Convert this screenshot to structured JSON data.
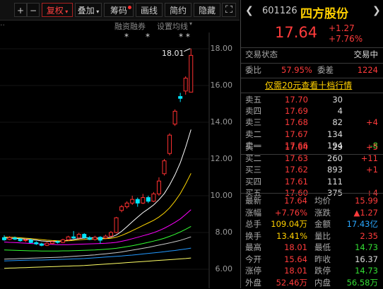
{
  "toolbar": {
    "add_label": "+",
    "minus_label": "−",
    "fuquan_label": "复权",
    "overlay_label": "叠加",
    "chips_label": "筹码",
    "draw_label": "画线",
    "simple_label": "简约",
    "hide_label": "隐藏"
  },
  "subbar": {
    "margin_label": "融资融券",
    "ma_settings_label": "设置均线",
    "markers": [
      "*",
      "*",
      "* *"
    ]
  },
  "chart": {
    "price_axis": [
      "18.00",
      "16.00",
      "14.00",
      "12.00",
      "10.00",
      "8.00",
      "6.00"
    ],
    "high_label": "18.01",
    "up_color": "#ff3030",
    "down_color": "#00e5ff",
    "candles": [
      {
        "o": 7.72,
        "c": 7.6,
        "h": 7.85,
        "l": 7.55
      },
      {
        "o": 7.62,
        "c": 7.72,
        "h": 7.8,
        "l": 7.58
      },
      {
        "o": 7.7,
        "c": 7.64,
        "h": 7.78,
        "l": 7.58
      },
      {
        "o": 7.64,
        "c": 7.55,
        "h": 7.7,
        "l": 7.5
      },
      {
        "o": 7.56,
        "c": 7.6,
        "h": 7.66,
        "l": 7.48
      },
      {
        "o": 7.58,
        "c": 7.45,
        "h": 7.66,
        "l": 7.42
      },
      {
        "o": 7.45,
        "c": 7.38,
        "h": 7.52,
        "l": 7.32
      },
      {
        "o": 7.38,
        "c": 7.3,
        "h": 7.44,
        "l": 7.25
      },
      {
        "o": 7.3,
        "c": 7.42,
        "h": 7.48,
        "l": 7.26
      },
      {
        "o": 7.4,
        "c": 7.5,
        "h": 7.56,
        "l": 7.36
      },
      {
        "o": 7.5,
        "c": 7.46,
        "h": 7.56,
        "l": 7.4
      },
      {
        "o": 7.46,
        "c": 7.6,
        "h": 7.66,
        "l": 7.42
      },
      {
        "o": 7.6,
        "c": 7.76,
        "h": 7.82,
        "l": 7.55
      },
      {
        "o": 7.76,
        "c": 7.7,
        "h": 8.08,
        "l": 7.65
      },
      {
        "o": 7.7,
        "c": 7.9,
        "h": 7.98,
        "l": 7.66
      },
      {
        "o": 7.9,
        "c": 7.72,
        "h": 7.96,
        "l": 7.66
      },
      {
        "o": 7.72,
        "c": 7.62,
        "h": 7.8,
        "l": 7.58
      },
      {
        "o": 7.62,
        "c": 7.74,
        "h": 7.82,
        "l": 7.56
      },
      {
        "o": 7.74,
        "c": 7.58,
        "h": 7.8,
        "l": 7.4
      },
      {
        "o": 7.7,
        "c": 7.8,
        "h": 7.88,
        "l": 7.64
      },
      {
        "o": 7.8,
        "c": 8.0,
        "h": 8.08,
        "l": 7.74
      },
      {
        "o": 8.0,
        "c": 8.8,
        "h": 8.85,
        "l": 7.95
      },
      {
        "o": 9.2,
        "c": 9.4,
        "h": 9.5,
        "l": 9.1
      },
      {
        "o": 9.4,
        "c": 9.6,
        "h": 9.7,
        "l": 9.3
      },
      {
        "o": 9.6,
        "c": 9.8,
        "h": 10.0,
        "l": 9.5
      },
      {
        "o": 9.8,
        "c": 9.6,
        "h": 9.9,
        "l": 9.4
      },
      {
        "o": 9.6,
        "c": 9.9,
        "h": 10.1,
        "l": 9.55
      },
      {
        "o": 9.9,
        "c": 9.7,
        "h": 10.0,
        "l": 9.6
      },
      {
        "o": 9.7,
        "c": 10.1,
        "h": 10.2,
        "l": 9.65
      },
      {
        "o": 10.1,
        "c": 10.8,
        "h": 11.0,
        "l": 10.0
      },
      {
        "o": 11.2,
        "c": 11.9,
        "h": 12.0,
        "l": 11.1
      },
      {
        "o": 12.3,
        "c": 13.3,
        "h": 13.4,
        "l": 12.2
      },
      {
        "o": 13.9,
        "c": 14.6,
        "h": 14.7,
        "l": 13.8
      },
      {
        "o": 15.4,
        "c": 15.3,
        "h": 15.6,
        "l": 15.1
      },
      {
        "o": 15.7,
        "c": 16.4,
        "h": 16.5,
        "l": 15.5
      },
      {
        "o": 15.64,
        "c": 17.64,
        "h": 18.01,
        "l": 15.64
      }
    ],
    "ma_lines": [
      {
        "color": "#ffffff",
        "values": [
          7.7,
          7.69,
          7.68,
          7.66,
          7.64,
          7.61,
          7.58,
          7.54,
          7.52,
          7.52,
          7.52,
          7.53,
          7.58,
          7.62,
          7.66,
          7.7,
          7.71,
          7.7,
          7.69,
          7.7,
          7.74,
          7.86,
          8.06,
          8.32,
          8.58,
          8.84,
          9.08,
          9.28,
          9.5,
          9.78,
          10.12,
          10.58,
          11.14,
          11.8,
          12.64,
          13.6
        ]
      },
      {
        "color": "#ffd700",
        "values": [
          7.75,
          7.74,
          7.73,
          7.71,
          7.69,
          7.67,
          7.64,
          7.61,
          7.58,
          7.56,
          7.55,
          7.54,
          7.55,
          7.57,
          7.6,
          7.62,
          7.64,
          7.64,
          7.65,
          7.66,
          7.68,
          7.74,
          7.84,
          7.96,
          8.1,
          8.24,
          8.38,
          8.52,
          8.66,
          8.84,
          9.06,
          9.34,
          9.7,
          10.12,
          10.64,
          11.22
        ]
      },
      {
        "color": "#ff00ff",
        "values": [
          7.48,
          7.46,
          7.45,
          7.43,
          7.42,
          7.4,
          7.39,
          7.37,
          7.36,
          7.35,
          7.34,
          7.34,
          7.34,
          7.35,
          7.36,
          7.37,
          7.38,
          7.39,
          7.4,
          7.41,
          7.43,
          7.46,
          7.52,
          7.58,
          7.66,
          7.74,
          7.82,
          7.9,
          7.99,
          8.1,
          8.23,
          8.38,
          8.55,
          8.74,
          8.98,
          9.24
        ]
      },
      {
        "color": "#33ff33",
        "values": [
          7.05,
          7.04,
          7.03,
          7.02,
          7.01,
          7.0,
          7.0,
          6.99,
          6.99,
          6.99,
          6.99,
          7.0,
          7.0,
          7.01,
          7.02,
          7.03,
          7.04,
          7.05,
          7.07,
          7.09,
          7.11,
          7.14,
          7.18,
          7.23,
          7.28,
          7.34,
          7.4,
          7.46,
          7.53,
          7.6,
          7.69,
          7.79,
          7.9,
          8.03,
          8.17,
          8.33
        ]
      },
      {
        "color": "#cccccc",
        "values": [
          6.55,
          6.56,
          6.57,
          6.58,
          6.59,
          6.6,
          6.61,
          6.62,
          6.63,
          6.64,
          6.65,
          6.66,
          6.68,
          6.7,
          6.72,
          6.74,
          6.76,
          6.78,
          6.81,
          6.84,
          6.87,
          6.9,
          6.94,
          6.99,
          7.04,
          7.09,
          7.14,
          7.19,
          7.25,
          7.31,
          7.37,
          7.43,
          7.5,
          7.57,
          7.66,
          7.76
        ]
      },
      {
        "color": "#2299ff",
        "values": [
          6.45,
          6.46,
          6.47,
          6.48,
          6.49,
          6.5,
          6.5,
          6.5,
          6.51,
          6.52,
          6.53,
          6.54,
          6.55,
          6.56,
          6.57,
          6.58,
          6.6,
          6.62,
          6.64,
          6.66,
          6.68,
          6.7,
          6.72,
          6.75,
          6.77,
          6.8,
          6.83,
          6.86,
          6.89,
          6.92,
          6.95,
          6.99,
          7.02,
          7.06,
          7.1,
          7.15
        ]
      },
      {
        "color": "#ffff66",
        "values": [
          6.05,
          6.06,
          6.07,
          6.08,
          6.09,
          6.1,
          6.11,
          6.12,
          6.13,
          6.14,
          6.15,
          6.16,
          6.17,
          6.18,
          6.19,
          6.2,
          6.22,
          6.24,
          6.26,
          6.28,
          6.3,
          6.32,
          6.34,
          6.36,
          6.38,
          6.4,
          6.42,
          6.44,
          6.46,
          6.48,
          6.5,
          6.52,
          6.54,
          6.56,
          6.58,
          6.61
        ]
      }
    ]
  },
  "quote": {
    "code": "601126",
    "name": "四方股份",
    "price": "17.64",
    "change": "+1.27",
    "change_pct": "+7.76%",
    "trade_status_label": "交易状态",
    "trade_status": "交易中",
    "weibi_label": "委比",
    "weibi": "57.95%",
    "weicha_label": "委差",
    "weicha": "1224",
    "l2_banner": "仅需20元查看十档行情",
    "sells": [
      {
        "label": "卖五",
        "price": "17.70",
        "vol": "30",
        "delta": ""
      },
      {
        "label": "卖四",
        "price": "17.69",
        "vol": "4",
        "delta": ""
      },
      {
        "label": "卖三",
        "price": "17.68",
        "vol": "82",
        "delta": "+4"
      },
      {
        "label": "卖二",
        "price": "17.67",
        "vol": "134",
        "delta": ""
      },
      {
        "label": "卖一",
        "price": "17.66",
        "vol": "194",
        "delta": "-8"
      }
    ],
    "buys": [
      {
        "label": "买一",
        "price": "17.64",
        "vol": "29",
        "delta": "+5"
      },
      {
        "label": "买二",
        "price": "17.63",
        "vol": "260",
        "delta": "+11"
      },
      {
        "label": "买三",
        "price": "17.62",
        "vol": "893",
        "delta": "+1"
      },
      {
        "label": "买四",
        "price": "17.61",
        "vol": "111",
        "delta": ""
      },
      {
        "label": "买五",
        "price": "17.60",
        "vol": "375",
        "delta": "+4"
      }
    ],
    "stats": [
      {
        "l1": "最新",
        "v1": "17.64",
        "c1": "red",
        "l2": "均价",
        "v2": "15.99",
        "c2": "red"
      },
      {
        "l1": "涨幅",
        "v1": "+7.76%",
        "c1": "red",
        "l2": "涨跌",
        "v2": "▲1.27",
        "c2": "red"
      },
      {
        "l1": "总手",
        "v1": "109.04万",
        "c1": "yellow",
        "l2": "金额",
        "v2": "17.43亿",
        "c2": "cyan"
      },
      {
        "l1": "换手",
        "v1": "13.41%",
        "c1": "yellow",
        "l2": "量比",
        "v2": "2.35",
        "c2": "red"
      },
      {
        "l1": "最高",
        "v1": "18.01",
        "c1": "red",
        "l2": "最低",
        "v2": "14.73",
        "c2": "green"
      },
      {
        "l1": "今开",
        "v1": "15.64",
        "c1": "red",
        "l2": "昨收",
        "v2": "16.37",
        "c2": "white"
      },
      {
        "l1": "涨停",
        "v1": "18.01",
        "c1": "red",
        "l2": "跌停",
        "v2": "14.73",
        "c2": "green"
      },
      {
        "l1": "外盘",
        "v1": "52.46万",
        "c1": "red",
        "l2": "内盘",
        "v2": "56.58万",
        "c2": "green"
      }
    ]
  }
}
